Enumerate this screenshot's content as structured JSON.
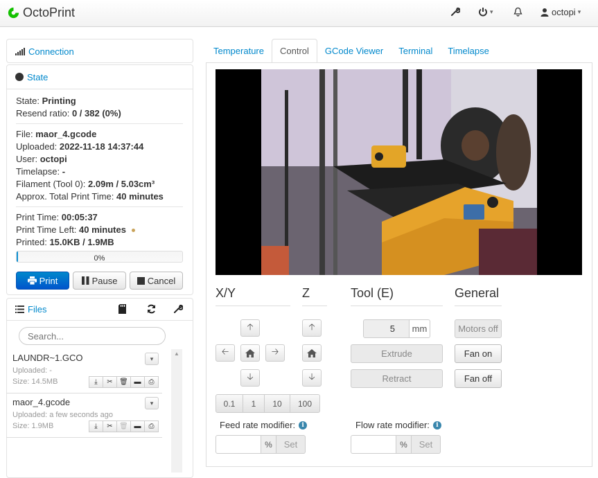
{
  "navbar": {
    "brand": "OctoPrint",
    "user": "octopi",
    "icons": [
      "wrench-icon",
      "power-icon",
      "bell-icon",
      "user-icon"
    ]
  },
  "sidebar": {
    "connection_title": "Connection",
    "state_title": "State",
    "state": {
      "state_label": "State:",
      "state_value": "Printing",
      "resend_label": "Resend ratio:",
      "resend_value": "0 / 382 (0%)",
      "file_label": "File:",
      "file_value": "maor_4.gcode",
      "uploaded_label": "Uploaded:",
      "uploaded_value": "2022-11-18 14:37:44",
      "user_label": "User:",
      "user_value": "octopi",
      "timelapse_label": "Timelapse:",
      "timelapse_value": "-",
      "filament_label": "Filament (Tool 0):",
      "filament_value": "2.09m / 5.03cm³",
      "approx_label": "Approx. Total Print Time:",
      "approx_value": "40 minutes",
      "print_time_label": "Print Time:",
      "print_time_value": "00:05:37",
      "time_left_label": "Print Time Left:",
      "time_left_value": "40 minutes",
      "printed_label": "Printed:",
      "printed_value": "15.0KB / 1.9MB",
      "progress_label": "0%",
      "progress_fraction": 0.008
    },
    "buttons": {
      "print": "Print",
      "pause": "Pause",
      "cancel": "Cancel"
    },
    "files_title": "Files",
    "search_placeholder": "Search...",
    "files": [
      {
        "name": "LAUNDR~1.GCO",
        "uploaded": "Uploaded: -",
        "size": "Size: 14.5MB"
      },
      {
        "name": "maor_4.gcode",
        "uploaded": "Uploaded: a few seconds ago",
        "size": "Size: 1.9MB"
      }
    ]
  },
  "tabs": [
    {
      "label": "Temperature"
    },
    {
      "label": "Control"
    },
    {
      "label": "GCode Viewer"
    },
    {
      "label": "Terminal"
    },
    {
      "label": "Timelapse"
    }
  ],
  "control": {
    "xy_title": "X/Y",
    "z_title": "Z",
    "tool_title": "Tool (E)",
    "general_title": "General",
    "steps": [
      "0.1",
      "1",
      "10",
      "100"
    ],
    "extrude_amount": "5",
    "extrude_unit": "mm",
    "extrude": "Extrude",
    "retract": "Retract",
    "motors_off": "Motors off",
    "fan_on": "Fan on",
    "fan_off": "Fan off",
    "feed_rate_label": "Feed rate modifier:",
    "flow_rate_label": "Flow rate modifier:",
    "percent": "%",
    "set": "Set"
  }
}
